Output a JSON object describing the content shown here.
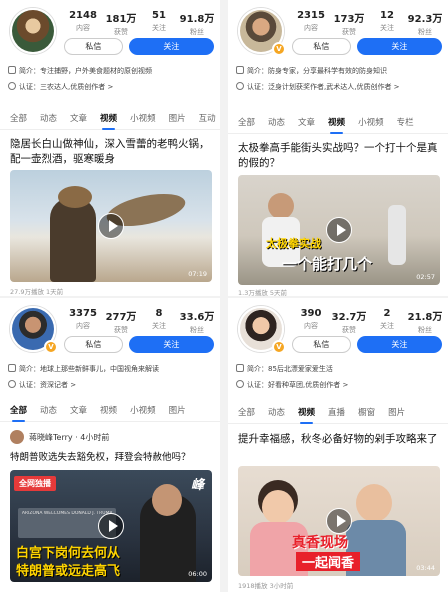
{
  "panels": {
    "tl": {
      "stats": [
        {
          "num": "2148",
          "label": "内容"
        },
        {
          "num": "181万",
          "label": "获赞"
        },
        {
          "num": "51",
          "label": "关注"
        },
        {
          "num": "91.8万",
          "label": "粉丝"
        }
      ],
      "message_label": "私信",
      "follow_label": "关注",
      "intro": "简介：专注捕野，户外美食题材的原创视频",
      "auth": "认证：三农达人,优质创作者 >",
      "tabs": [
        "全部",
        "动态",
        "文章",
        "视频",
        "小视频",
        "图片",
        "互动"
      ],
      "active_tab": "视频",
      "post_title": "隐居长白山做神仙，深入雪蕾的老鸭火锅，配一壶烈酒，驱寒暖身",
      "duration": "07:19",
      "meta": "27.9万播放 1天前"
    },
    "tr": {
      "stats": [
        {
          "num": "2315",
          "label": "内容"
        },
        {
          "num": "173万",
          "label": "获赞"
        },
        {
          "num": "12",
          "label": "关注"
        },
        {
          "num": "92.3万",
          "label": "粉丝"
        }
      ],
      "message_label": "私信",
      "follow_label": "关注",
      "intro": "简介：防身专家，分享最科学有效的防身知识",
      "auth": "认证：泛身计划获奖作者,武术达人,优质创作者 >",
      "tabs": [
        "全部",
        "动态",
        "文章",
        "视频",
        "小视频",
        "专栏"
      ],
      "active_tab": "视频",
      "post_title": "太极拳高手能街头实战吗？一个打十个是真的假的？",
      "cover_text_1": "太极拳实战",
      "cover_text_2": "一个能打几个",
      "duration": "02:57",
      "meta": "1.3万播放 5天前"
    },
    "bl": {
      "stats": [
        {
          "num": "3375",
          "label": "内容"
        },
        {
          "num": "277万",
          "label": "获赞"
        },
        {
          "num": "8",
          "label": "关注"
        },
        {
          "num": "33.6万",
          "label": "粉丝"
        }
      ],
      "message_label": "私信",
      "follow_label": "关注",
      "intro": "简介：地球上那些新鲜事儿，中国视角来解读",
      "auth": "认证：资深记者 >",
      "tabs": [
        "全部",
        "动态",
        "文章",
        "视频",
        "小视频",
        "图片"
      ],
      "active_tab": "全部",
      "poster_name": "蒋晓峰Terry · 4小时前",
      "post_title": "特朗普败选失去豁免权，拜登会特赦他吗？",
      "badge": "全网独播",
      "cover_text_1": "白宫下岗何去何从",
      "cover_text_2": "特朗普或远走高飞",
      "cover_logo": "峰",
      "sign_text": "ARIZONA WELCOMES DONALD J. TRUMP",
      "duration": "06:00"
    },
    "br": {
      "stats": [
        {
          "num": "390",
          "label": "内容"
        },
        {
          "num": "32.7万",
          "label": "获赞"
        },
        {
          "num": "2",
          "label": "关注"
        },
        {
          "num": "21.8万",
          "label": "粉丝"
        }
      ],
      "message_label": "私信",
      "follow_label": "关注",
      "intro": "简介：85后北漂爱家爱生活",
      "auth": "认证：好看种草团,优质创作者 >",
      "tabs": [
        "全部",
        "动态",
        "视频",
        "直播",
        "橱窗",
        "图片"
      ],
      "active_tab": "视频",
      "post_title": "提升幸福感，秋冬必备好物的剁手攻略来了",
      "cover_text_1": "真香现场",
      "cover_text_2": "一起闻香",
      "duration": "03:44",
      "meta": "1918播放 3小时前"
    }
  },
  "colors": {
    "accent": "#1e6ff5",
    "badge": "#f5a623"
  }
}
